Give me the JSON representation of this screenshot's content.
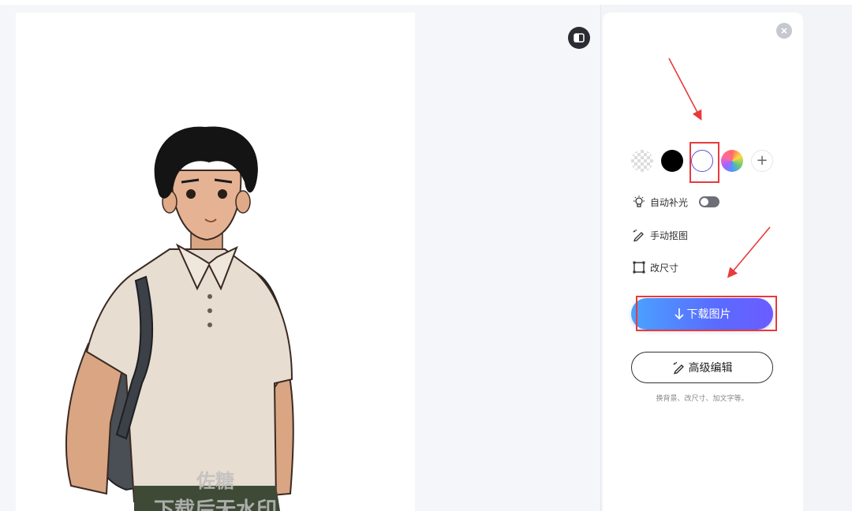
{
  "watermark": {
    "line1": "佐糖",
    "line2": "下载后无水印"
  },
  "panel": {
    "swatches": [
      {
        "name": "transparent",
        "selected": false
      },
      {
        "name": "black",
        "color": "#000000",
        "selected": false
      },
      {
        "name": "white",
        "color": "#ffffff",
        "selected": true
      },
      {
        "name": "rainbow-picker",
        "selected": false
      },
      {
        "name": "add",
        "glyph": "+",
        "selected": false
      }
    ],
    "menu": {
      "auto_light": "自动补光",
      "auto_light_enabled": false,
      "manual_cutout": "手动抠图",
      "resize": "改尺寸"
    },
    "download_label": "下载图片",
    "advanced_label": "高级编辑",
    "advanced_hint": "换背景、改尺寸、加文字等。"
  },
  "colors": {
    "accent_start": "#4aa3ff",
    "accent_end": "#6b5cff",
    "annotation_red": "#e83a3a"
  }
}
